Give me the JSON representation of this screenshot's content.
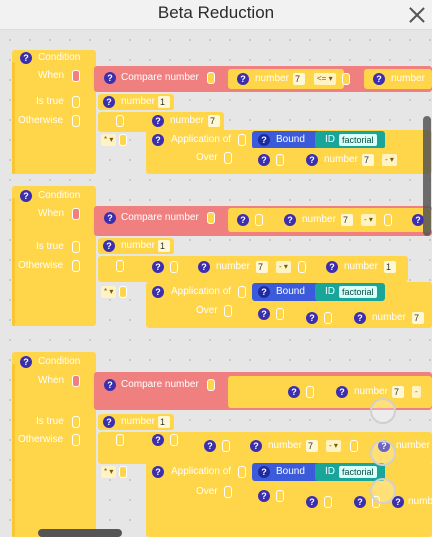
{
  "window": {
    "title": "Beta Reduction"
  },
  "blocks": {
    "condition": "Condition",
    "when": "When",
    "is_true": "Is true",
    "otherwise": "Otherwise",
    "compare_number": "Compare number",
    "number": "number",
    "application_of": "Application of",
    "over": "Over",
    "bound": "Bound",
    "id": "ID",
    "factorial": "factorial",
    "help": "?"
  },
  "values": {
    "seven": "7",
    "one": "1",
    "op_le": "<=",
    "op_minus": "-",
    "op_mult": "*",
    "dropdown_arrow": "▾"
  }
}
